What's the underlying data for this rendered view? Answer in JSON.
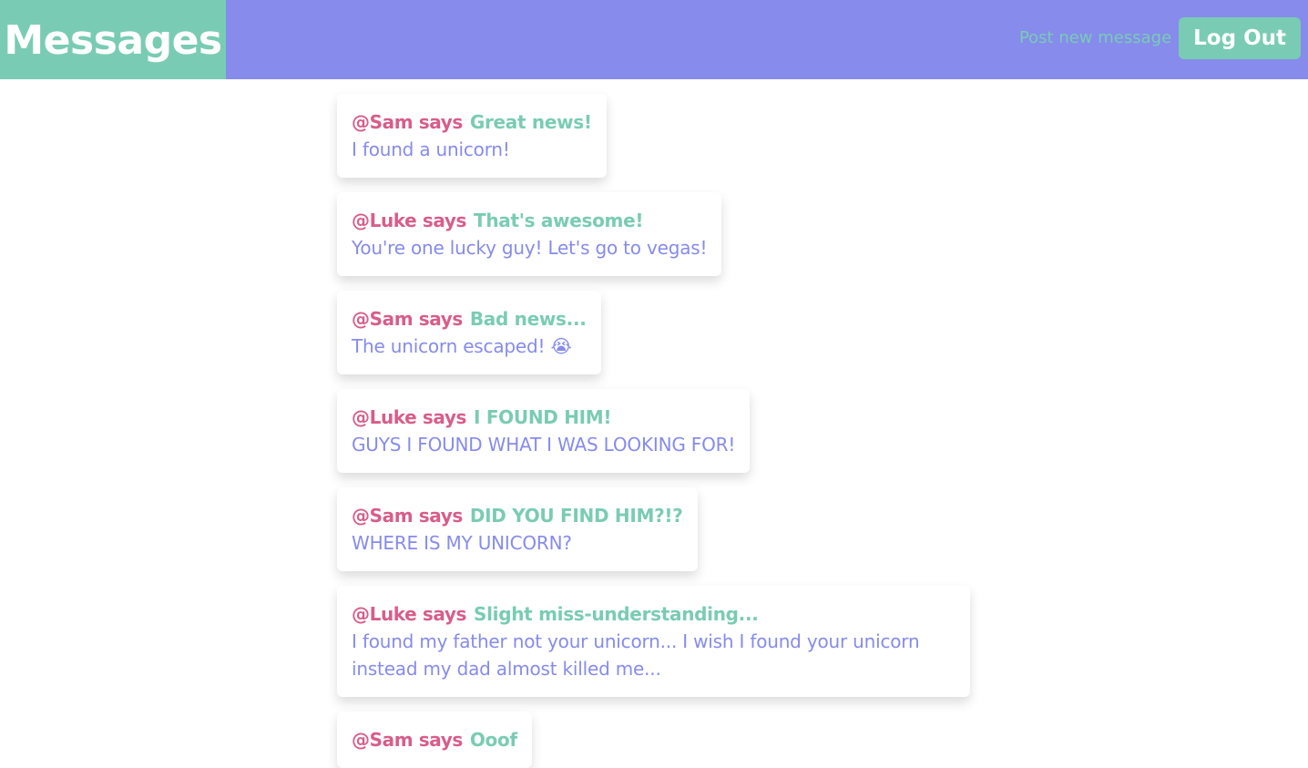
{
  "header": {
    "brand": "Messages",
    "post_new_message": "Post new message",
    "logout": "Log Out"
  },
  "messages": [
    {
      "author": "@Sam says",
      "subject": "Great news!",
      "body": "I found a unicorn!"
    },
    {
      "author": "@Luke says",
      "subject": "That's awesome!",
      "body": "You're one lucky guy! Let's go to vegas!"
    },
    {
      "author": "@Sam says",
      "subject": "Bad news...",
      "body": "The unicorn escaped! 😭"
    },
    {
      "author": "@Luke says",
      "subject": "I FOUND HIM!",
      "body": "GUYS I FOUND WHAT I WAS LOOKING FOR!"
    },
    {
      "author": "@Sam says",
      "subject": "DID YOU FIND HIM?!?",
      "body": "WHERE IS MY UNICORN?"
    },
    {
      "author": "@Luke says",
      "subject": "Slight miss-understanding...",
      "body": "I found my father not your unicorn... I wish I found your unicorn instead my dad almost killed me..."
    },
    {
      "author": "@Sam says",
      "subject": "Ooof",
      "body": ""
    }
  ],
  "colors": {
    "header": "#868bec",
    "brand": "#79ccb3",
    "author": "#d85d8b",
    "subject": "#79ccb3",
    "body": "#868bec"
  }
}
